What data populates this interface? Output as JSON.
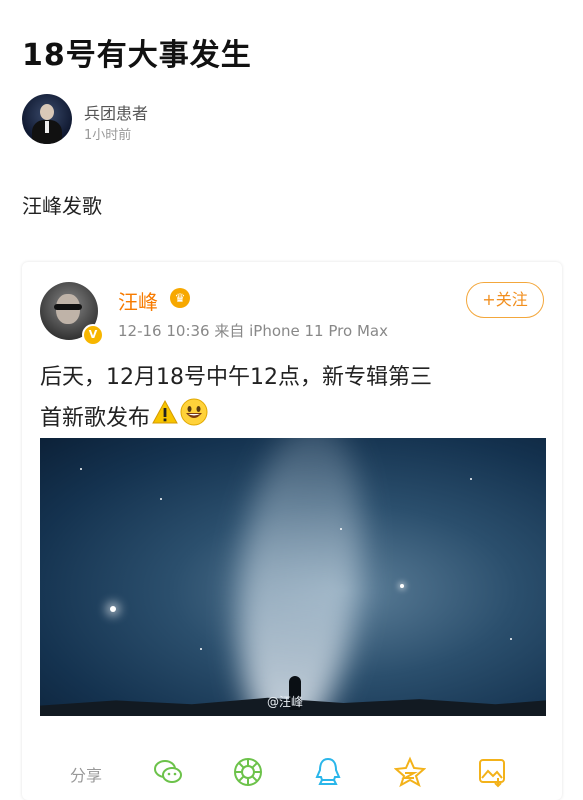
{
  "post": {
    "title": "18号有大事发生",
    "author_name": "兵团患者",
    "time": "1小时前",
    "text": "汪峰发歌"
  },
  "weibo_card": {
    "name": "汪峰",
    "meta": "12-16 10:36  来自 iPhone 11 Pro Max",
    "follow_label": "+关注",
    "content_line1": "后天，12月18号中午12点，新专辑第三",
    "content_line2": "首新歌发布",
    "watermark": "@汪峰",
    "share_label": "分享",
    "verified_badge": "V",
    "crown_glyph": "♛",
    "share_targets": [
      "wechat-icon",
      "moments-icon",
      "qq-icon",
      "qzone-icon",
      "save-image-icon"
    ]
  },
  "colors": {
    "accent_orange": "#f77b00",
    "follow_border": "#f3a73c",
    "share_green": "#6cc24a",
    "share_blue": "#2ab6ea",
    "share_yellow": "#f3b21a"
  }
}
